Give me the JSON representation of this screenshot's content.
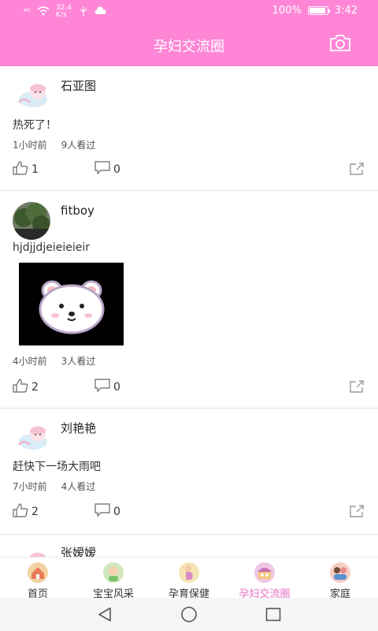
{
  "status_bar": {
    "signal": "⁴ᴳ",
    "speed": "32.4 K/s",
    "battery": "100%",
    "time": "3:42"
  },
  "app_bar": {
    "title": "孕妇交流圈"
  },
  "posts": [
    {
      "author": "石亚图",
      "content": "热死了！",
      "time": "1小时前",
      "views": "9人看过",
      "likes": "1",
      "comments": "0"
    },
    {
      "author": "fitboy",
      "content": "hjdjjdjeieieieir",
      "time": "4小时前",
      "views": "3人看过",
      "likes": "2",
      "comments": "0"
    },
    {
      "author": "刘艳艳",
      "content": "赶快下一场大雨吧",
      "time": "7小时前",
      "views": "4人看过",
      "likes": "2",
      "comments": "0"
    },
    {
      "author": "张嫒嫒"
    }
  ],
  "tabs": [
    {
      "label": "首页",
      "icon": "home-icon",
      "color": "#f2b37a"
    },
    {
      "label": "宝宝风采",
      "icon": "baby-icon",
      "color": "#b9e0a6"
    },
    {
      "label": "孕育保健",
      "icon": "pregnant-icon",
      "color": "#f4dca0"
    },
    {
      "label": "孕妇交流圈",
      "icon": "community-icon",
      "color": "#e9a7d8",
      "active": true
    },
    {
      "label": "家庭",
      "icon": "family-icon",
      "color": "#f3b0a0"
    }
  ],
  "colors": {
    "accent": "#ff86d6",
    "active_tab": "#e86fc4"
  }
}
